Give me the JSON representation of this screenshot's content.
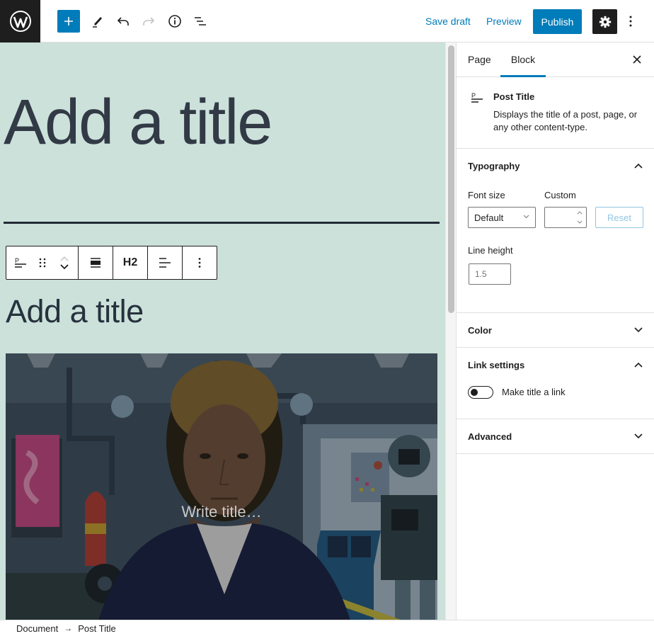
{
  "header": {
    "logo": "wordpress-logo",
    "tools": [
      {
        "name": "add-block",
        "icon": "plus-icon"
      },
      {
        "name": "tools",
        "icon": "pencil-icon"
      },
      {
        "name": "undo",
        "icon": "undo-icon"
      },
      {
        "name": "redo",
        "icon": "redo-icon",
        "disabled": true
      },
      {
        "name": "details",
        "icon": "info-icon"
      },
      {
        "name": "list-view",
        "icon": "list-view-icon"
      }
    ],
    "save_draft_label": "Save draft",
    "preview_label": "Preview",
    "publish_label": "Publish",
    "settings_icon": "gear-icon",
    "options_icon": "more-vertical-icon"
  },
  "canvas": {
    "site_title": "Add a title",
    "block_toolbar": {
      "block_icon": "post-title-icon",
      "drag_icon": "drag-handle-icon",
      "move_up_icon": "chevron-up-icon",
      "move_down_icon": "chevron-down-icon",
      "align_icon": "align-wide-icon",
      "heading_level": "H2",
      "text_align_icon": "align-left-icon",
      "options_icon": "more-vertical-icon"
    },
    "post_title": "Add a title",
    "cover": {
      "placeholder": "Write title…"
    },
    "colors": {
      "background": "#cbe1da",
      "title_text": "#323a46"
    }
  },
  "sidebar": {
    "tabs": [
      {
        "label": "Page",
        "active": false
      },
      {
        "label": "Block",
        "active": true
      }
    ],
    "close_icon": "close-icon",
    "block_card": {
      "icon": "post-title-icon",
      "title": "Post Title",
      "description": "Displays the title of a post, page, or any other content-type."
    },
    "typography": {
      "title": "Typography",
      "expanded": true,
      "font_size_label": "Font size",
      "font_size_value": "Default",
      "custom_label": "Custom",
      "custom_value": "",
      "reset_label": "Reset",
      "line_height_label": "Line height",
      "line_height_placeholder": "1.5"
    },
    "color": {
      "title": "Color",
      "expanded": false
    },
    "link_settings": {
      "title": "Link settings",
      "expanded": true,
      "toggle_label": "Make title a link",
      "toggle_on": false
    },
    "advanced": {
      "title": "Advanced",
      "expanded": false
    }
  },
  "footer": {
    "breadcrumbs": [
      "Document",
      "Post Title"
    ],
    "separator": "→"
  },
  "accent_color": "#007cba"
}
